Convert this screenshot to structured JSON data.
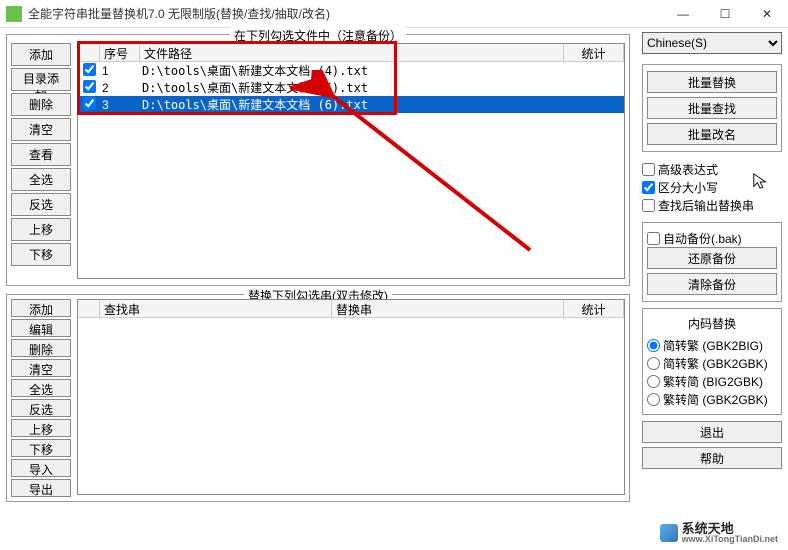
{
  "window": {
    "title": "全能字符串批量替换机7.0 无限制版(替换/查找/抽取/改名)"
  },
  "upper": {
    "group_label": "在下列勾选文件中（注意备份）",
    "buttons": [
      "添加",
      "目录添加",
      "删除",
      "清空",
      "查看",
      "全选",
      "反选",
      "上移",
      "下移"
    ],
    "headers": {
      "seq": "序号",
      "path": "文件路径",
      "stat": "统计"
    },
    "rows": [
      {
        "seq": "1",
        "path": "D:\\tools\\桌面\\新建文本文档 (4).txt",
        "checked": true,
        "selected": false
      },
      {
        "seq": "2",
        "path": "D:\\tools\\桌面\\新建文本文档 (5).txt",
        "checked": true,
        "selected": false
      },
      {
        "seq": "3",
        "path": "D:\\tools\\桌面\\新建文本文档 (6).txt",
        "checked": true,
        "selected": true
      }
    ]
  },
  "lower": {
    "group_label": "替换下列勾选串(双击修改)",
    "buttons": [
      "添加",
      "编辑",
      "删除",
      "清空",
      "全选",
      "反选",
      "上移",
      "下移",
      "导入",
      "导出"
    ],
    "headers": {
      "find": "查找串",
      "repl": "替换串",
      "stat": "统计"
    }
  },
  "right": {
    "language": "Chinese(S)",
    "batch": {
      "replace": "批量替换",
      "find": "批量查找",
      "rename": "批量改名"
    },
    "opts": {
      "advanced": {
        "label": "高级表达式",
        "checked": false
      },
      "case": {
        "label": "区分大小写",
        "checked": true
      },
      "output": {
        "label": "查找后输出替换串",
        "checked": false
      }
    },
    "backup": {
      "auto": {
        "label": "自动备份(.bak)",
        "checked": false
      },
      "restore": "还原备份",
      "clear": "清除备份"
    },
    "encode": {
      "title": "内码替换",
      "items": [
        "简转繁 (GBK2BIG)",
        "简转繁 (GBK2GBK)",
        "繁转简 (BIG2GBK)",
        "繁转简 (GBK2GBK)"
      ],
      "selected": 0
    },
    "exit": "退出",
    "help": "帮助"
  },
  "watermark": {
    "cn": "系统天地",
    "url": "www.XiTongTianDi.net"
  }
}
